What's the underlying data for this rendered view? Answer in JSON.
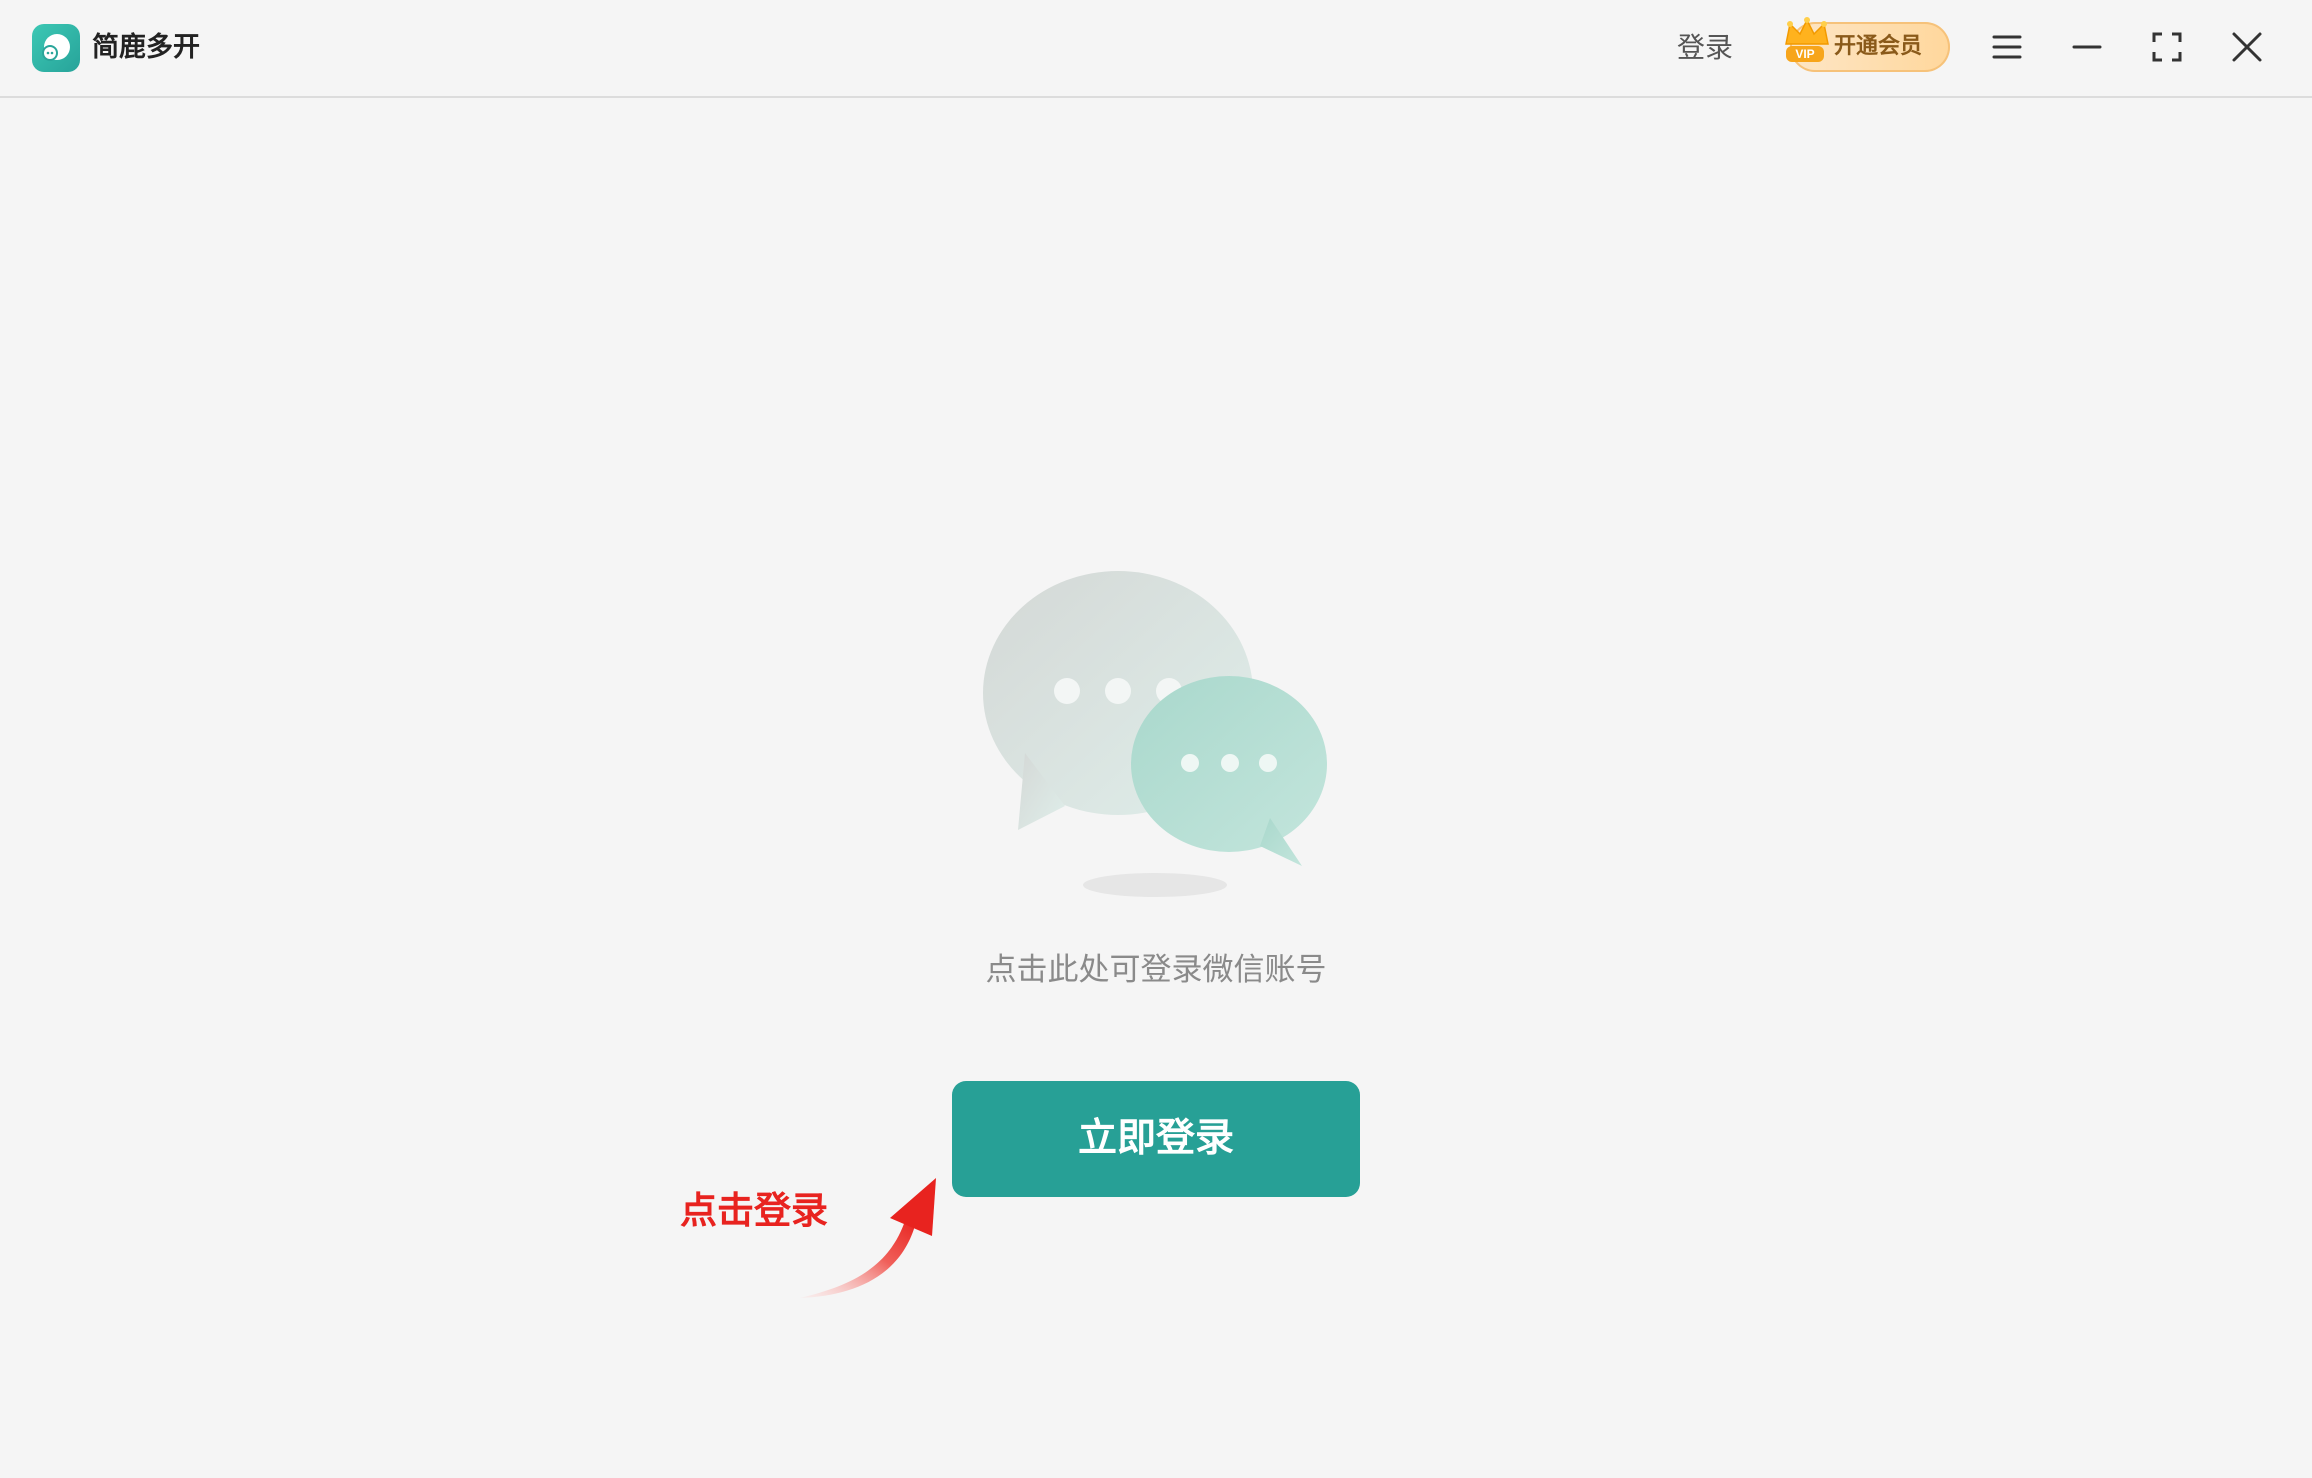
{
  "app": {
    "title": "简鹿多开"
  },
  "titlebar": {
    "login_label": "登录",
    "vip_badge": "VIP",
    "vip_label": "开通会员",
    "menu_icon": "hamburger-menu-icon",
    "minimize_icon": "minimize-icon",
    "maximize_icon": "fullscreen-icon",
    "close_icon": "close-icon"
  },
  "main": {
    "hint": "点击此处可登录微信账号",
    "login_button": "立即登录",
    "annotation": "点击登录"
  },
  "colors": {
    "accent": "#27a096",
    "annotation": "#e8231f",
    "vip_text": "#8a5a1a",
    "background": "#f5f5f5"
  }
}
